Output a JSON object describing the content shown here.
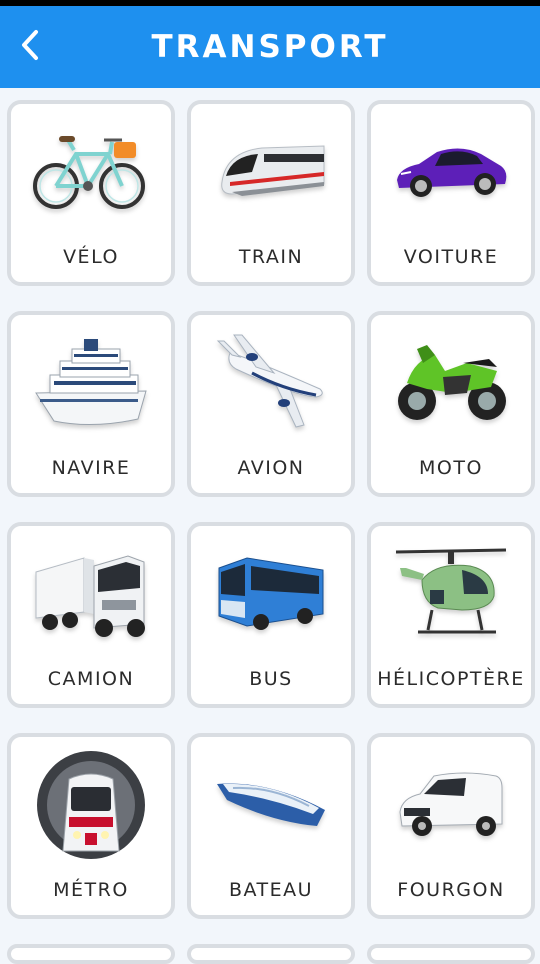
{
  "header": {
    "title": "TRANSPORT",
    "back_icon": "chevron-left-icon"
  },
  "colors": {
    "header_bg": "#1e90ef",
    "card_border": "#d9dde2",
    "page_bg": "#f2f6fb"
  },
  "items": [
    {
      "label": "VÉLO",
      "icon": "bicycle-icon"
    },
    {
      "label": "TRAIN",
      "icon": "train-icon"
    },
    {
      "label": "VOITURE",
      "icon": "car-icon"
    },
    {
      "label": "NAVIRE",
      "icon": "ship-icon"
    },
    {
      "label": "AVION",
      "icon": "airplane-icon"
    },
    {
      "label": "MOTO",
      "icon": "motorcycle-icon"
    },
    {
      "label": "CAMION",
      "icon": "truck-icon"
    },
    {
      "label": "BUS",
      "icon": "bus-icon"
    },
    {
      "label": "HÉLICOPTÈRE",
      "icon": "helicopter-icon"
    },
    {
      "label": "MÉTRO",
      "icon": "metro-icon"
    },
    {
      "label": "BATEAU",
      "icon": "boat-icon"
    },
    {
      "label": "FOURGON",
      "icon": "van-icon"
    }
  ]
}
